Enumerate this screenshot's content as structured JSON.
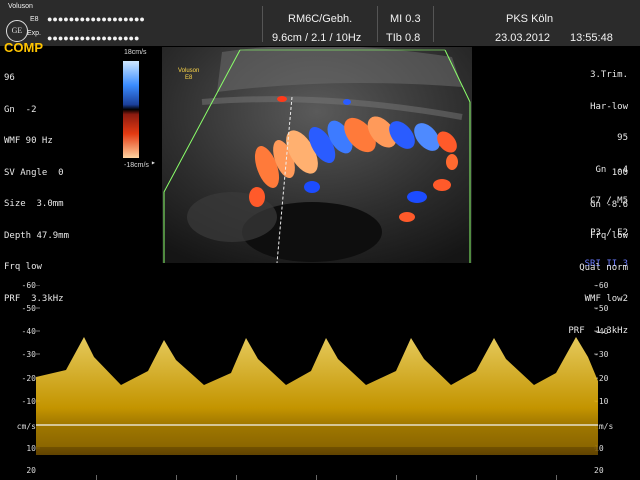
{
  "header": {
    "brand": "Voluson",
    "brand_model": "E8",
    "brand_sub": "Exp.",
    "patient_masked_1": "●●●●●●●●●●●●●●●●●●",
    "patient_masked_2": "●●●●●●●●●●●●●●●●●",
    "probe": "RM6C/Gebh.",
    "scan_params": "9.6cm / 2.1 / 10Hz",
    "mi": "MI  0.3",
    "tib": "TIb  0.8",
    "hospital": "PKS Köln",
    "date": "23.03.2012",
    "time": "13:55:48"
  },
  "left_panel": {
    "mode": "COMP",
    "lines": [
      "96",
      "Gn  -2",
      "WMF 90 Hz",
      "SV Angle  0",
      "Size  3.0mm",
      "Depth 47.9mm",
      "Frq low",
      "PRF  3.3kHz"
    ]
  },
  "right_panel_top": {
    "lines": [
      "3.Trim.",
      "Har-low",
      "95",
      "Gn  -4",
      "C7 / M5",
      "P3 / E2"
    ],
    "sri": "SRI II 3"
  },
  "right_panel_bottom": {
    "lines": [
      "100",
      "Gn -8.6",
      "Frq low",
      "Qual norm",
      "WMF low2",
      "PRF  1.3kHz"
    ]
  },
  "colorbar": {
    "top_label": "18cm/s",
    "bottom_label": "-18cm/s"
  },
  "image_label": {
    "brand": "Voluson",
    "model": "E8"
  },
  "spectrum": {
    "unit": "cm/s",
    "ticks": [
      "-60",
      "-50",
      "-40",
      "-30",
      "-20",
      "-10",
      "10",
      "20"
    ]
  }
}
